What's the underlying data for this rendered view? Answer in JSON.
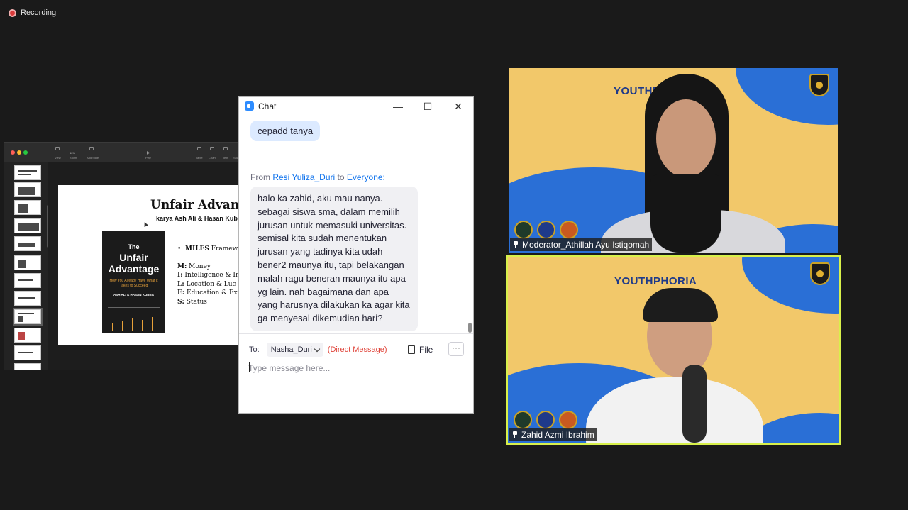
{
  "recording": {
    "label": "Recording"
  },
  "keynote": {
    "toolbar": {
      "view": "View",
      "zoom_value": "60%",
      "zoom": "Zoom",
      "add_slide": "Add Slide",
      "play": "Play",
      "table": "Table",
      "chart": "Chart",
      "text": "Text",
      "shape": "Sha"
    },
    "slide": {
      "title": "Unfair Advantag",
      "subtitle": "karya Ash Ali & Hasan Kubb",
      "book": {
        "line1": "The",
        "line2": "Unfair",
        "line3": "Advantage",
        "tagline": "How You Already Have What It Takes to Succeed",
        "authors": "ASH ALI & HASAN KUBBA"
      },
      "bullet_bold": "MILES",
      "bullet_rest": " Framework",
      "items": [
        {
          "letter": "M:",
          "text": " Money"
        },
        {
          "letter": "I:",
          "text": " Intelligence & In"
        },
        {
          "letter": "L:",
          "text": " Location & Luc"
        },
        {
          "letter": "E:",
          "text": " Education & Ex"
        },
        {
          "letter": "S:",
          "text": " Status"
        }
      ]
    }
  },
  "chat": {
    "title": "Chat",
    "minimize": "—",
    "maximize": "☐",
    "close": "✕",
    "prev_message": "cepadd tanya",
    "from_prefix": "From ",
    "from_name": "Resi Yuliza_Duri",
    "to_word": " to ",
    "to_name": "Everyone:",
    "message": "halo ka zahid, aku mau nanya. sebagai siswa sma, dalam memilih jurusan untuk memasuki universitas. semisal kita sudah menentukan jurusan yang tadinya kita udah bener2 maunya itu, tapi belakangan malah ragu beneran maunya itu apa yg lain. nah bagaimana dan apa yang harusnya dilakukan ka agar kita ga menyesal dikemudian hari?",
    "to_label": "To:",
    "recipient": "Nasha_Duri",
    "direct_label": "(Direct Message)",
    "file_label": "File",
    "more_label": "···",
    "input_placeholder": "Type message here..."
  },
  "videos": [
    {
      "brand": "YOUTHPHORIA",
      "name": "Moderator_Athillah Ayu Istiqomah"
    },
    {
      "brand": "YOUTHPHORIA",
      "name": "Zahid Azmi Ibrahim"
    }
  ],
  "colors": {
    "background": "#1a1a1a",
    "active_speaker_border": "#d8f04a",
    "zoom_blue": "#0e72ed",
    "direct_message": "#e0463c",
    "bubble_self": "#dceaff",
    "bubble_other": "#f0f0f3"
  }
}
